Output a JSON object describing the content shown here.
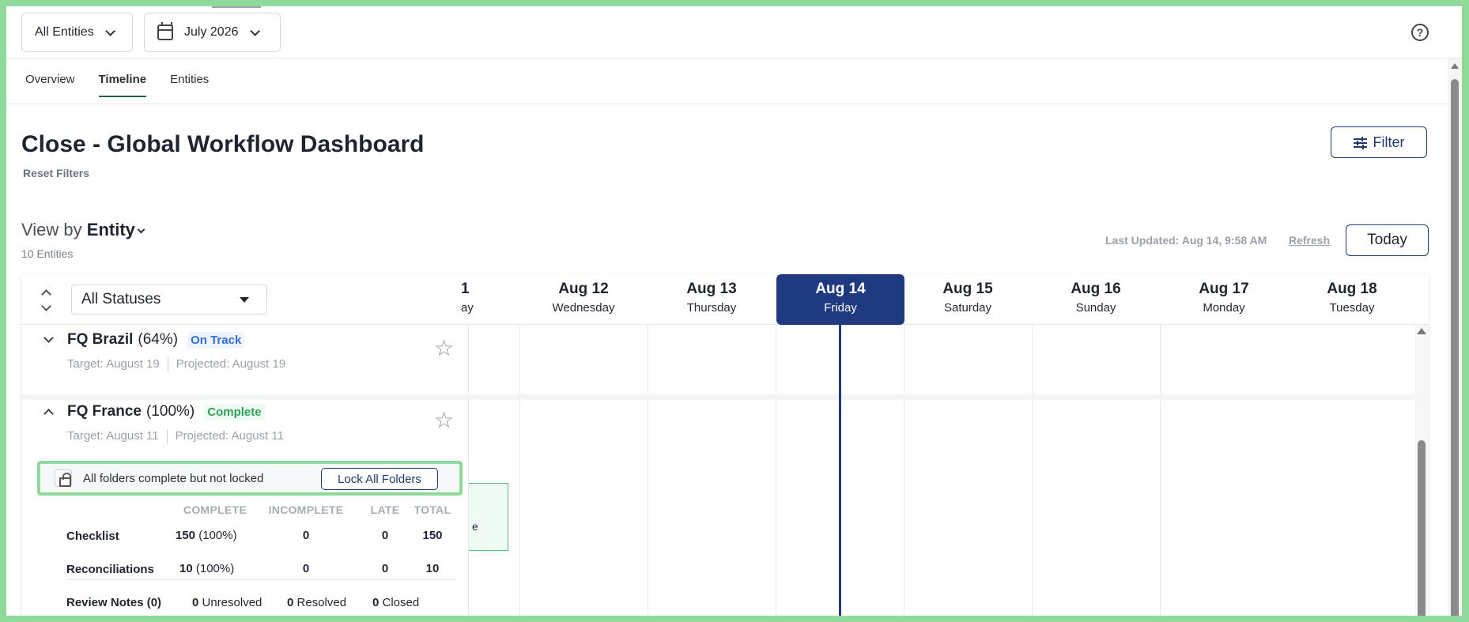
{
  "toolbar": {
    "entity_select": "All Entities",
    "period_select": "July 2026"
  },
  "tabs": [
    {
      "label": "Overview",
      "active": false
    },
    {
      "label": "Timeline",
      "active": true
    },
    {
      "label": "Entities",
      "active": false
    }
  ],
  "page": {
    "title": "Close - Global Workflow Dashboard",
    "reset_filters": "Reset Filters",
    "filter_label": "Filter",
    "view_by_prefix": "View by",
    "view_by_value": "Entity",
    "entity_count": "10 Entities",
    "last_updated": "Last Updated: Aug 14, 9:58 AM",
    "refresh": "Refresh",
    "today": "Today"
  },
  "timeline": {
    "status_filter": "All Statuses",
    "partial_day": {
      "date": "1",
      "weekday": "ay"
    },
    "days": [
      {
        "date": "Aug 12",
        "weekday": "Wednesday",
        "today": false
      },
      {
        "date": "Aug 13",
        "weekday": "Thursday",
        "today": false
      },
      {
        "date": "Aug 14",
        "weekday": "Friday",
        "today": true
      },
      {
        "date": "Aug 15",
        "weekday": "Saturday",
        "today": false
      },
      {
        "date": "Aug 16",
        "weekday": "Sunday",
        "today": false
      },
      {
        "date": "Aug 17",
        "weekday": "Monday",
        "today": false
      },
      {
        "date": "Aug 18",
        "weekday": "Tuesday",
        "today": false
      }
    ],
    "bar_text": "e"
  },
  "entities": [
    {
      "name": "FQ Brazil",
      "percent": "(64%)",
      "status": "On Track",
      "target": "Target: August 19",
      "projected": "Projected: August 19"
    },
    {
      "name": "FQ France",
      "percent": "(100%)",
      "status": "Complete",
      "target": "Target: August 11",
      "projected": "Projected: August 11",
      "lock_message": "All folders complete but not locked",
      "lock_button": "Lock All Folders",
      "stats_headers": [
        "COMPLETE",
        "INCOMPLETE",
        "LATE",
        "TOTAL"
      ],
      "checklist": {
        "label": "Checklist",
        "complete": "150",
        "complete_pct": "(100%)",
        "incomplete": "0",
        "late": "0",
        "total": "150"
      },
      "reconciliations": {
        "label": "Reconciliations",
        "complete": "10",
        "complete_pct": "(100%)",
        "incomplete": "0",
        "late": "0",
        "total": "10"
      },
      "review_notes": {
        "label": "Review Notes (0)",
        "unresolved_count": "0",
        "unresolved": "Unresolved",
        "resolved_count": "0",
        "resolved": "Resolved",
        "closed_count": "0",
        "closed": "Closed"
      }
    }
  ],
  "colors": {
    "frame": "#8fd99b",
    "brand_navy": "#1f3a80",
    "on_track": "#2f6fd8",
    "complete": "#2fa05a"
  }
}
